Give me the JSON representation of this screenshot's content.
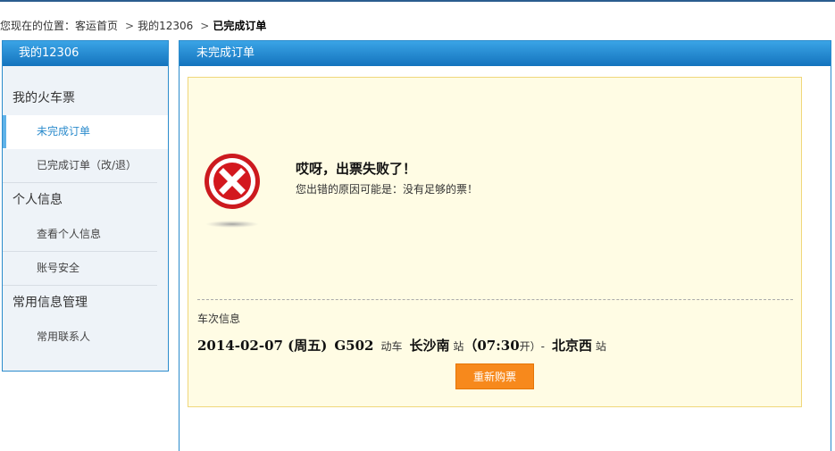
{
  "breadcrumb": {
    "prefix": "您现在的位置：",
    "home": "客运首页",
    "sep": ">",
    "my12306": "我的12306",
    "current": "已完成订单"
  },
  "sidebar": {
    "title": "我的12306",
    "groups": [
      {
        "label": "我的火车票",
        "items": [
          {
            "label": "未完成订单",
            "active": true
          },
          {
            "label": "已完成订单（改/退）"
          }
        ]
      },
      {
        "label": "个人信息",
        "items": [
          {
            "label": "查看个人信息"
          },
          {
            "label": "账号安全"
          }
        ]
      },
      {
        "label": "常用信息管理",
        "items": [
          {
            "label": "常用联系人"
          }
        ]
      }
    ]
  },
  "main": {
    "title": "未完成订单",
    "error_title": "哎呀，出票失败了！",
    "error_reason": "您出错的原因可能是：没有足够的票！",
    "train_info_title": "车次信息",
    "train": {
      "date": "2014-02-07 (周五)",
      "train_no": "G502",
      "train_type": "动车",
      "from_station": "长沙南",
      "station_suffix": "站",
      "depart": "（07:30",
      "depart_suffix": "开）-",
      "to_station": "北京西",
      "to_suffix": "站"
    },
    "rebuy_button": "重新购票"
  },
  "colors": {
    "header_blue": "#1e86cf",
    "box_bg": "#fffce4",
    "box_border": "#f0d77a",
    "button_orange": "#f7891c",
    "error_red": "#d0141a"
  },
  "icons": {
    "error": "error-x-icon"
  }
}
